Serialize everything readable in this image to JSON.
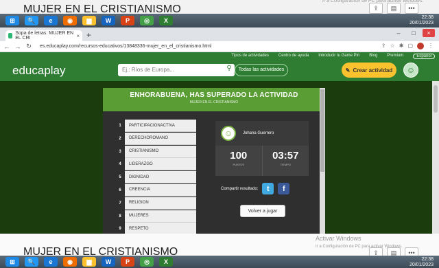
{
  "document": {
    "title": "MUJER EN EL CRISTIANISMO",
    "activate_title": "Activar Windows",
    "activate_sub": "Ir a Configuración de PC para activar Windows.",
    "tools": [
      "share",
      "note",
      "more"
    ]
  },
  "taskbar": {
    "apps": [
      "windows",
      "explorer",
      "ie",
      "firefox",
      "files",
      "word",
      "powerpoint",
      "chrome",
      "excel"
    ],
    "clock_time": "22:38",
    "clock_date": "20/01/2023"
  },
  "browser": {
    "tab_title": "Sopa de letras: MUJER EN EL CRI",
    "new_tab": "+",
    "url": "es.educaplay.com/recursos-educativos/13848336-mujer_en_el_cristianismo.html",
    "window_controls": [
      "–",
      "□",
      "×"
    ]
  },
  "site": {
    "logo": "educaplay",
    "top_menu": [
      "Tipos de actividades",
      "Centro de ayuda",
      "Introducir tu Game Pin",
      "Blog",
      "Premium",
      "Español"
    ],
    "search_placeholder": "Ej.: Ríos de Europa...",
    "search_filter": "Todas las actividades",
    "create_label": "Crear actividad"
  },
  "result": {
    "congrats": "ENHORABUENA, HAS SUPERADO LA ACTIVIDAD",
    "activity_name": "MUJER EN EL CRISTIANISMO",
    "words": [
      {
        "num": "1",
        "word": "PARTICIPACIONACTIVA"
      },
      {
        "num": "2",
        "word": "DERECHOROMANO"
      },
      {
        "num": "3",
        "word": "CRISTIANISMO"
      },
      {
        "num": "4",
        "word": "LIDERAZGO"
      },
      {
        "num": "5",
        "word": "DIGNIDAD"
      },
      {
        "num": "6",
        "word": "CREENCIA"
      },
      {
        "num": "7",
        "word": "RELIGION"
      },
      {
        "num": "8",
        "word": "MUJERES"
      },
      {
        "num": "9",
        "word": "RESPETO"
      }
    ],
    "user_name": "Johana Guerrero",
    "score": "100",
    "score_label": "PUNTOS",
    "time": "03:57",
    "time_label": "TIEMPO",
    "share_label": "Compartir resultado:",
    "replay_label": "Volver a jugar"
  },
  "colors": {
    "header_green": "#2e7d32",
    "panel_green": "#5a9d34",
    "create_yellow": "#f9c22e",
    "twitter": "#3fa9e0",
    "facebook": "#3b5998"
  }
}
